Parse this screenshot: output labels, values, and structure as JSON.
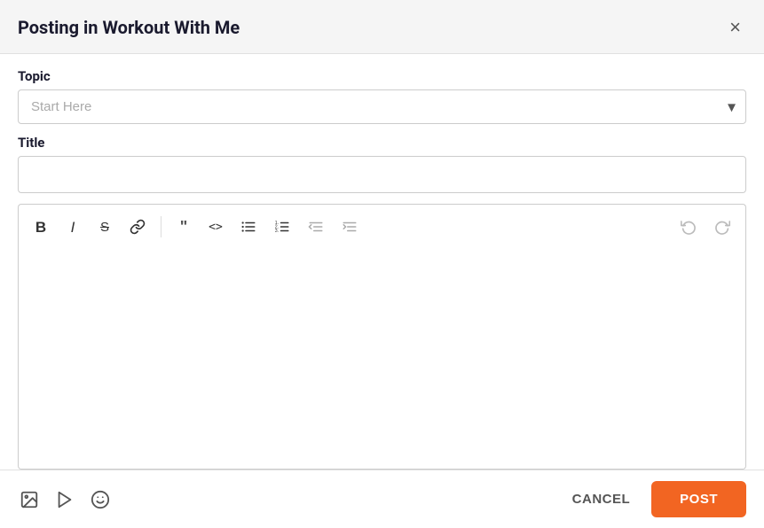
{
  "dialog": {
    "title": "Posting in Workout With Me",
    "close_label": "×"
  },
  "topic": {
    "label": "Topic",
    "placeholder": "Start Here",
    "options": [
      "Start Here"
    ]
  },
  "title_field": {
    "label": "Title",
    "placeholder": "",
    "value": ""
  },
  "toolbar": {
    "bold_label": "B",
    "italic_label": "I",
    "strikethrough_label": "S",
    "link_label": "🔗",
    "quote_label": "❝",
    "code_label": "<>",
    "bullet_list_label": "≡",
    "numbered_list_label": "≡",
    "indent_left_label": "≡",
    "indent_right_label": "≡",
    "undo_label": "↩",
    "redo_label": "↪"
  },
  "editor": {
    "placeholder": ""
  },
  "footer": {
    "image_icon": "image",
    "video_icon": "video",
    "emoji_icon": "emoji",
    "cancel_label": "CANCEL",
    "post_label": "POST"
  },
  "colors": {
    "accent": "#f26522",
    "header_bg": "#f5f5f5"
  }
}
